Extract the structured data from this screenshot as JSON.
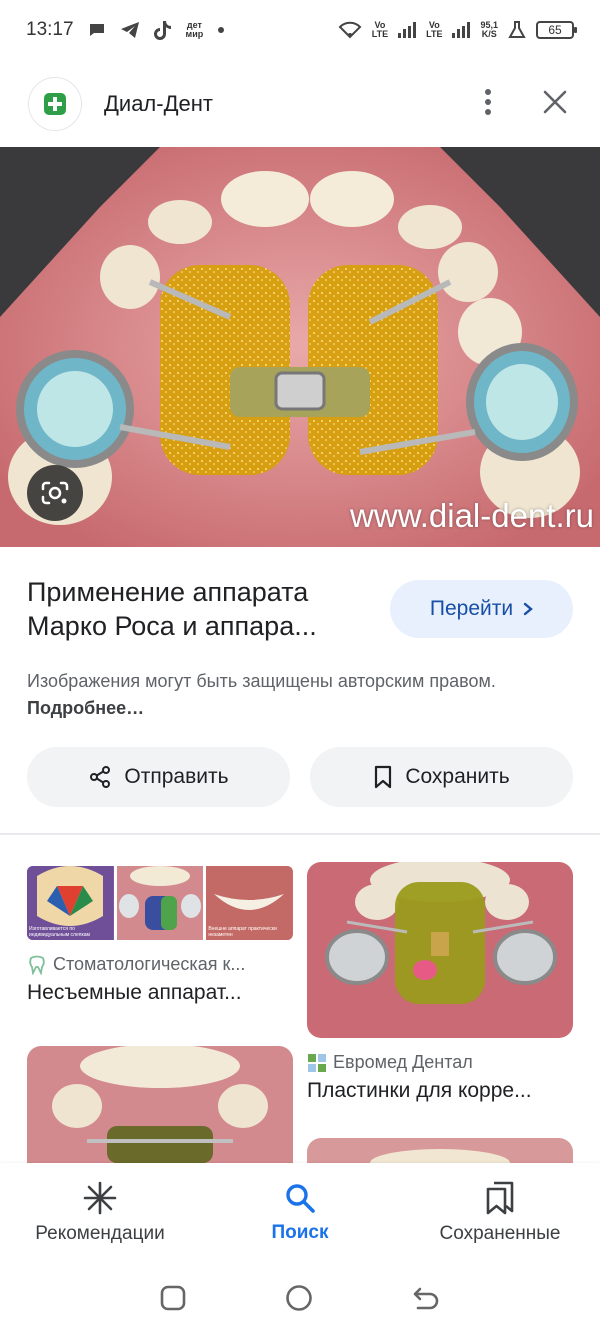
{
  "status_bar": {
    "time": "13:17",
    "network_speed": "95,1",
    "network_speed_unit": "K/S",
    "battery": "65",
    "carrier_tag_1": "Vo\nLTE",
    "carrier_tag_2": "Vo\nLTE",
    "notif_label": "дет\nмир"
  },
  "header": {
    "site_name": "Диал-Дент"
  },
  "hero": {
    "watermark": "www.dial-dent.ru"
  },
  "result": {
    "title": "Применение аппарата Марко Роса и аппара...",
    "visit_label": "Перейти",
    "copyright_text": "Изображения могут быть защищены авторским правом.",
    "copyright_more": "Подробнее…",
    "share_label": "Отправить",
    "save_label": "Сохранить"
  },
  "related": [
    {
      "source": "Стоматологическая к...",
      "title": "Несъемные аппарат...",
      "strip_caption_1": "Изготавливается по индивидуальным слепкам",
      "strip_caption_2": "Внешне аппарат практически незаметен"
    },
    {
      "source": "Евромед Дентал",
      "title": "Пластинки для корре..."
    }
  ],
  "bottom_nav": {
    "items": [
      {
        "label": "Рекомендации",
        "icon": "asterisk-icon"
      },
      {
        "label": "Поиск",
        "icon": "search-icon"
      },
      {
        "label": "Сохраненные",
        "icon": "collections-icon"
      }
    ]
  },
  "colors": {
    "accent": "#1a73e8",
    "visit_bg": "#e8f0fe",
    "chip_bg": "#f1f3f4"
  }
}
